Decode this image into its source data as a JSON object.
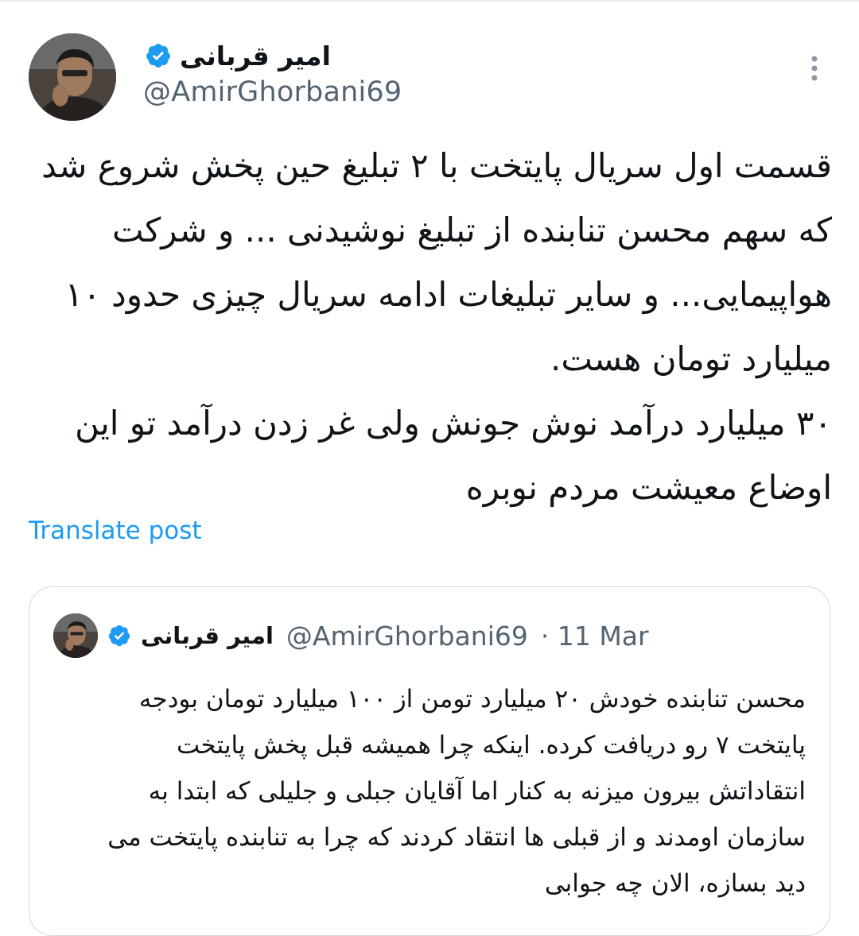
{
  "author": {
    "display_name": "امیر قربانی",
    "handle": "@AmirGhorbani69",
    "avatar_icon": "profile-photo",
    "verified_icon": "verified-badge-icon"
  },
  "tweet": {
    "paragraph_1": "قسمت اول سریال پایتخت با ۲ تبلیغ حین پخش شروع شد که سهم محسن تنابنده از تبلیغ نوشیدنی ... و شرکت هواپیمایی... و سایر تبلیغات ادامه سریال چیزی حدود ۱۰ میلیارد تومان هست.",
    "paragraph_2": "۳۰ میلیارد درآمد نوش جونش ولی غر زدن درآمد تو این اوضاع معیشت مردم نوبره"
  },
  "translate_label": "Translate post",
  "quote": {
    "display_name": "امیر قربانی",
    "handle": "@AmirGhorbani69",
    "date_meta": "· 11 Mar",
    "text": "محسن تنابنده خودش ۲۰ میلیارد تومن از ۱۰۰ میلیارد تومان بودجه پایتخت ۷ رو دریافت کرده. اینکه چرا همیشه قبل پخش پایتخت انتقاداتش بیرون میزنه به کنار اما آقایان جبلی و جلیلی که ابتدا به سازمان اومدند و از قبلی ها انتقاد کردند که چرا به تنابنده پایتخت می دید بسازه، الان چه جوابی"
  },
  "colors": {
    "accent": "#1d9bf0",
    "text": "#0f1419",
    "muted": "#536471",
    "border": "#cfd9de"
  }
}
